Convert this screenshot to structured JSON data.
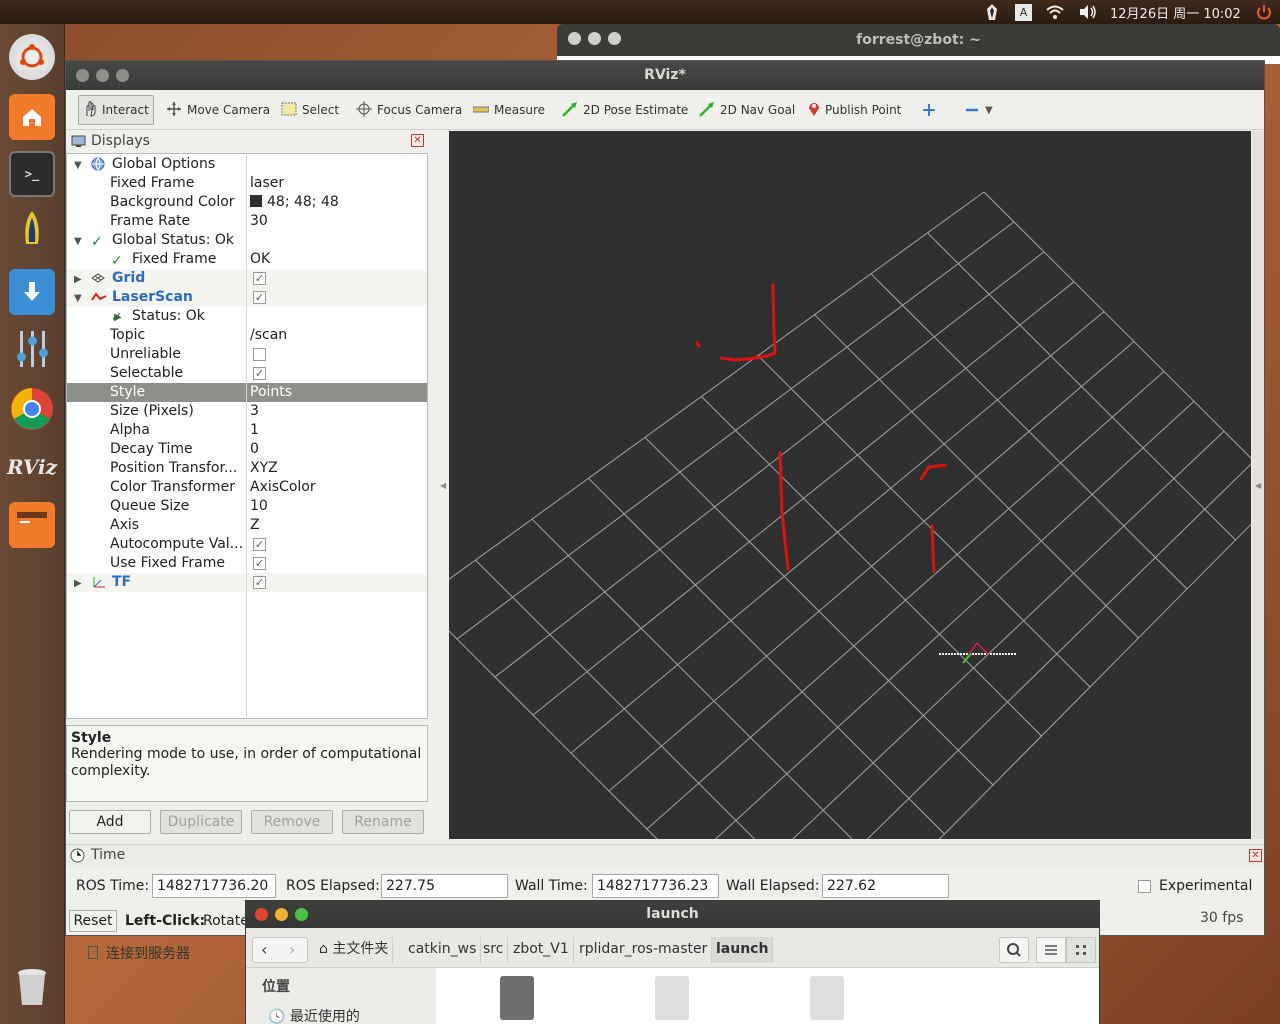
{
  "topbar": {
    "clock": "12月26日 周一 10:02",
    "tray_icons": [
      "nvidia-icon",
      "keyboard-indicator-icon",
      "wifi-icon",
      "volume-icon",
      "power-icon"
    ],
    "keyboard_letter": "A"
  },
  "launcher": {
    "items": [
      "ubuntu-logo",
      "files",
      "terminal",
      "rocket",
      "software-updater",
      "settings",
      "chrome",
      "rviz",
      "presentation",
      "trash"
    ],
    "rviz_label": "RViz"
  },
  "terminal_window": {
    "title": "forrest@zbot: ~"
  },
  "rviz": {
    "title": "RViz*",
    "toolbar": {
      "interact": "Interact",
      "move_camera": "Move Camera",
      "select": "Select",
      "focus_camera": "Focus Camera",
      "measure": "Measure",
      "pose_estimate": "2D Pose Estimate",
      "nav_goal": "2D Nav Goal",
      "publish_point": "Publish Point"
    },
    "displays": {
      "title": "Displays",
      "rows": [
        {
          "k": "Global Options",
          "v": ""
        },
        {
          "k": "Fixed Frame",
          "v": "laser"
        },
        {
          "k": "Background Color",
          "v": "48; 48; 48"
        },
        {
          "k": "Frame Rate",
          "v": "30"
        },
        {
          "k": "Global Status: Ok",
          "v": ""
        },
        {
          "k": "Fixed Frame",
          "v": "OK"
        },
        {
          "k": "Grid",
          "v": ""
        },
        {
          "k": "LaserScan",
          "v": ""
        },
        {
          "k": "Status: Ok",
          "v": ""
        },
        {
          "k": "Topic",
          "v": "/scan"
        },
        {
          "k": "Unreliable",
          "v": ""
        },
        {
          "k": "Selectable",
          "v": ""
        },
        {
          "k": "Style",
          "v": "Points"
        },
        {
          "k": "Size (Pixels)",
          "v": "3"
        },
        {
          "k": "Alpha",
          "v": "1"
        },
        {
          "k": "Decay Time",
          "v": "0"
        },
        {
          "k": "Position Transfor...",
          "v": "XYZ"
        },
        {
          "k": "Color Transformer",
          "v": "AxisColor"
        },
        {
          "k": "Queue Size",
          "v": "10"
        },
        {
          "k": "Axis",
          "v": "Z"
        },
        {
          "k": "Autocompute Val...",
          "v": ""
        },
        {
          "k": "Use Fixed Frame",
          "v": ""
        },
        {
          "k": "TF",
          "v": ""
        }
      ],
      "background_swatch": "#303030",
      "description_title": "Style",
      "description_text": "Rendering mode to use, in order of computational complexity.",
      "buttons": {
        "add": "Add",
        "duplicate": "Duplicate",
        "remove": "Remove",
        "rename": "Rename"
      }
    },
    "view": {
      "background": "#303030",
      "grid_color": "#a0a0a0",
      "scan_color": "#e11010"
    },
    "time": {
      "title": "Time",
      "ros_time_label": "ROS Time:",
      "ros_time": "1482717736.20",
      "ros_elapsed_label": "ROS Elapsed:",
      "ros_elapsed": "227.75",
      "wall_time_label": "Wall Time:",
      "wall_time": "1482717736.23",
      "wall_elapsed_label": "Wall Elapsed:",
      "wall_elapsed": "227.62",
      "experimental": "Experimental"
    },
    "status": {
      "reset": "Reset",
      "hint_bold": "Left-Click:",
      "hint": "Rotate",
      "fps": "30 fps",
      "server": "连接到服务器"
    }
  },
  "nautilus": {
    "title": "launch",
    "crumbs": [
      "主文件夹",
      "catkin_ws",
      "src",
      "zbot_V1",
      "rplidar_ros-master",
      "launch"
    ],
    "sidebar_heading": "位置",
    "sidebar_item": "最近使用的"
  }
}
